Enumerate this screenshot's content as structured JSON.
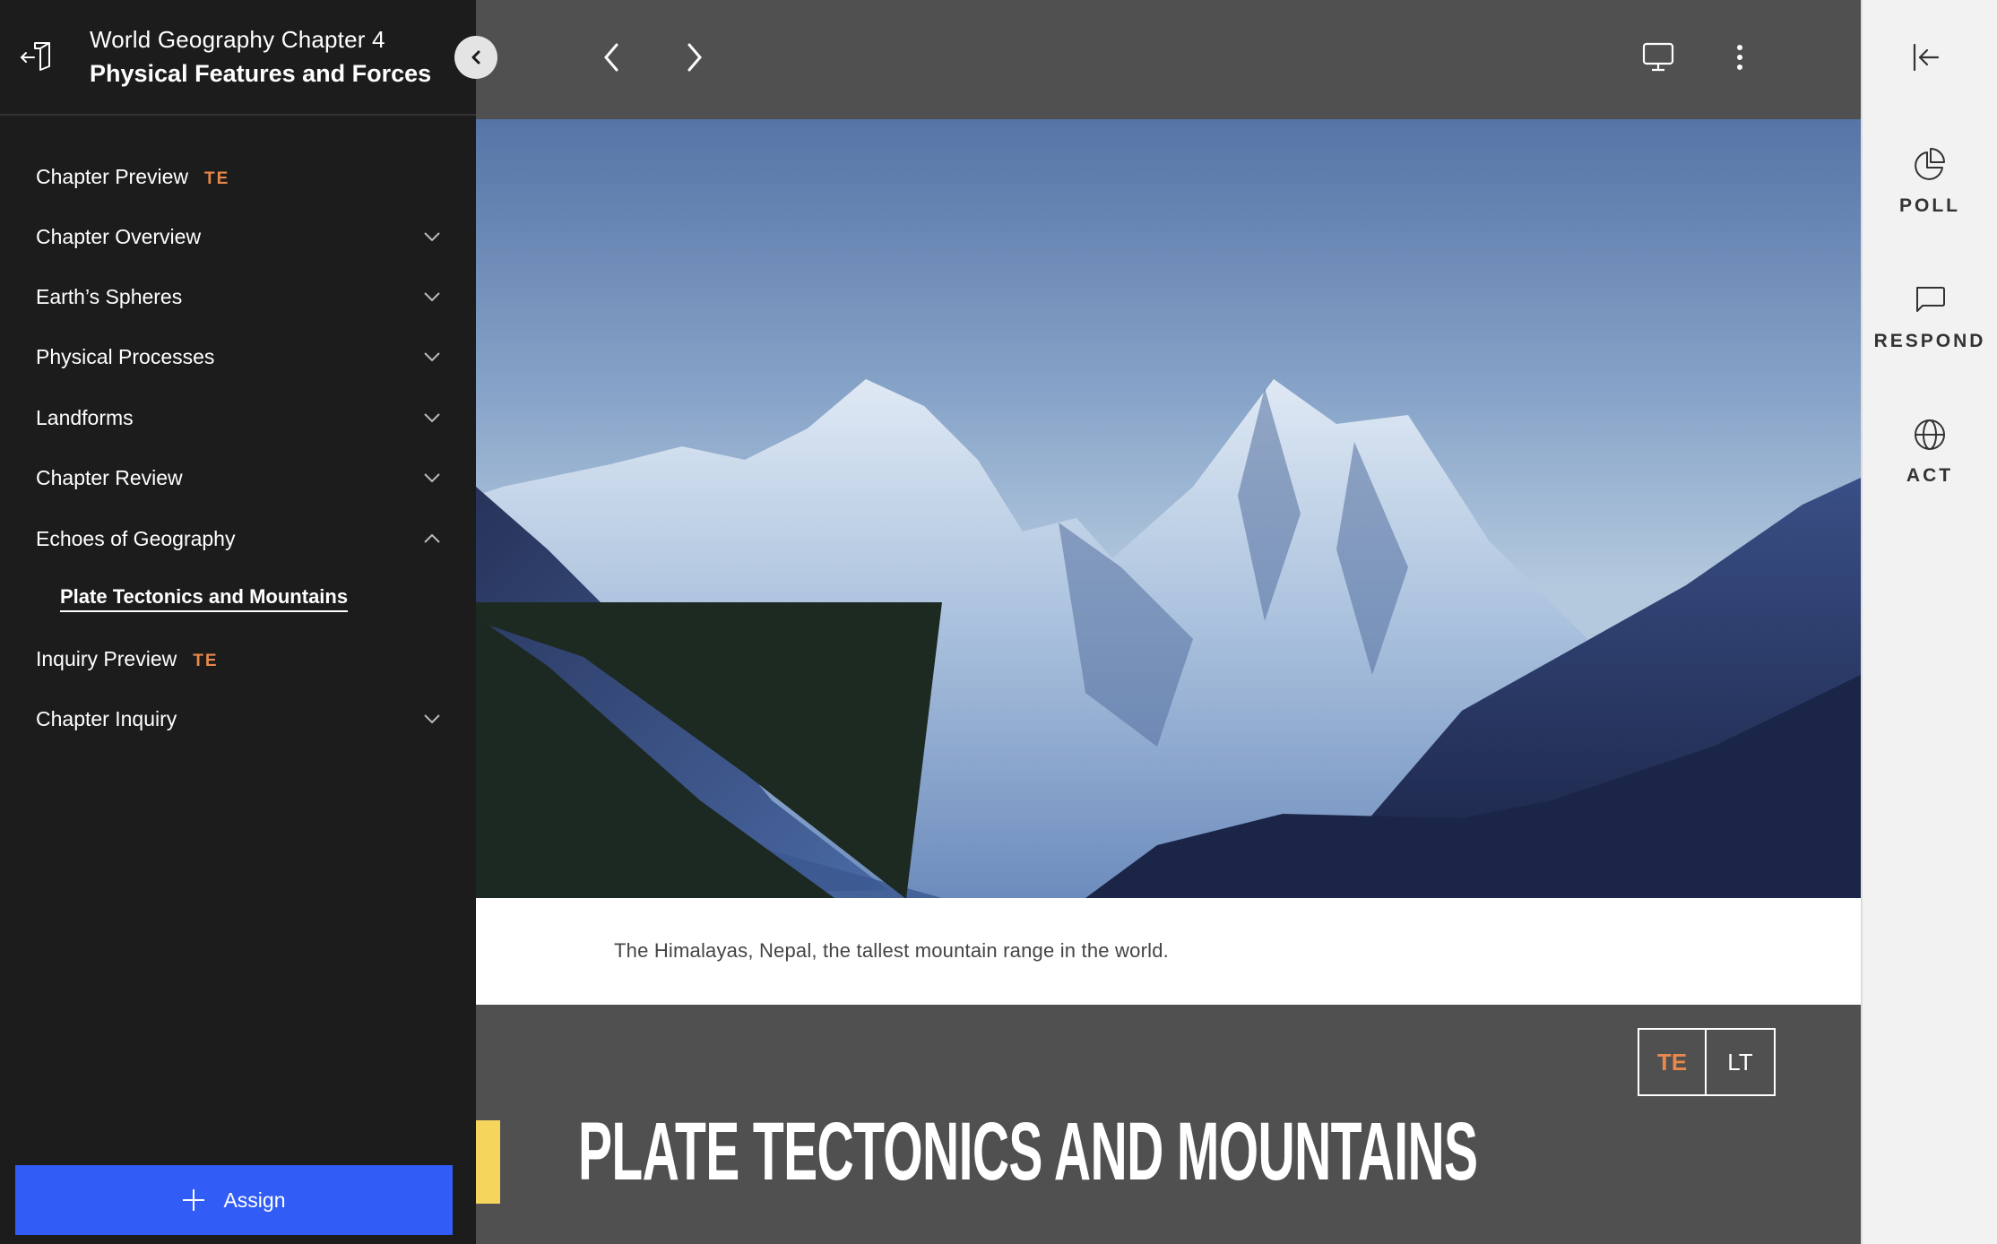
{
  "header": {
    "book_title": "World Geography Chapter 4",
    "chapter_title": "Physical Features and Forces"
  },
  "sidebar": {
    "items": [
      {
        "label": "Chapter Preview",
        "badge": "TE",
        "expandable": false
      },
      {
        "label": "Chapter Overview",
        "expandable": true,
        "expanded": false
      },
      {
        "label": "Earth’s Spheres",
        "expandable": true,
        "expanded": false
      },
      {
        "label": "Physical Processes",
        "expandable": true,
        "expanded": false
      },
      {
        "label": "Landforms",
        "expandable": true,
        "expanded": false
      },
      {
        "label": "Chapter Review",
        "expandable": true,
        "expanded": false
      },
      {
        "label": "Echoes of Geography",
        "expandable": true,
        "expanded": true
      },
      {
        "label": "Plate Tectonics and Mountains",
        "sub": true,
        "active": true
      },
      {
        "label": "Inquiry Preview",
        "badge": "TE",
        "expandable": false
      },
      {
        "label": "Chapter Inquiry",
        "expandable": true,
        "expanded": false
      }
    ],
    "assign_label": "Assign"
  },
  "topbar": {
    "icons": [
      "exit-book-icon",
      "collapse-sidebar-icon",
      "previous-page-icon",
      "next-page-icon",
      "present-monitor-icon",
      "more-options-icon"
    ]
  },
  "main": {
    "image_alt": "Snow-covered Himalayan peaks under a blue sky",
    "caption": "The Himalayas, Nepal, the tallest mountain range in the world.",
    "toggle": {
      "te_label": "TE",
      "lt_label": "LT"
    },
    "section_title": "PLATE TECTONICS AND MOUNTAINS"
  },
  "right_panel": {
    "tools": [
      {
        "label": "POLL",
        "icon": "pie-chart-icon"
      },
      {
        "label": "RESPOND",
        "icon": "chat-bubble-icon"
      },
      {
        "label": "ACT",
        "icon": "globe-icon"
      }
    ]
  },
  "colors": {
    "sidebar_bg": "#1c1c1c",
    "main_bg": "#505050",
    "accent_orange": "#e8884a",
    "assign_blue": "#315cf5",
    "highlight_yellow": "#f6d55c",
    "right_panel_bg": "#f2f2f2"
  }
}
